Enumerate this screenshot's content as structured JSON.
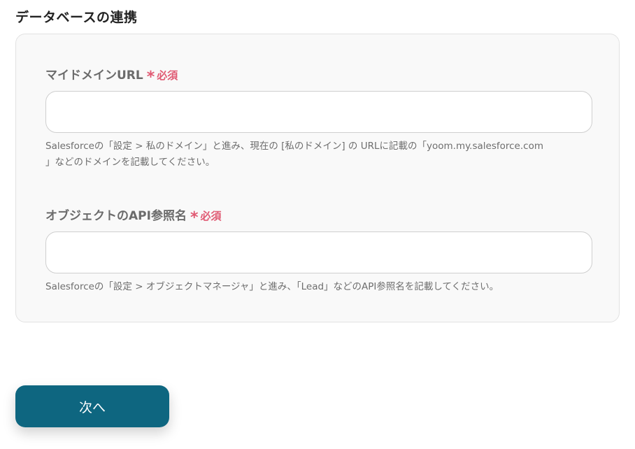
{
  "section": {
    "title": "データベースの連携"
  },
  "fields": [
    {
      "label": "マイドメインURL",
      "required_mark": "*",
      "required_text": "必須",
      "value": "",
      "placeholder": "",
      "help_lines": [
        "Salesforceの「設定 > 私のドメイン」と進み、現在の [私のドメイン] の URLに記載の「yoom.my.salesforce.com",
        "」などのドメインを記載してください。"
      ]
    },
    {
      "label": "オブジェクトのAPI参照名",
      "required_mark": "*",
      "required_text": "必須",
      "value": "",
      "placeholder": "",
      "help_lines": [
        "Salesforceの「設定 > オブジェクトマネージャ」と進み、「Lead」などのAPI参照名を記載してください。"
      ]
    }
  ],
  "actions": {
    "next_label": "次へ"
  },
  "colors": {
    "accent": "#0e6680",
    "required": "#e05a73",
    "card_bg": "#f9f9f9"
  }
}
